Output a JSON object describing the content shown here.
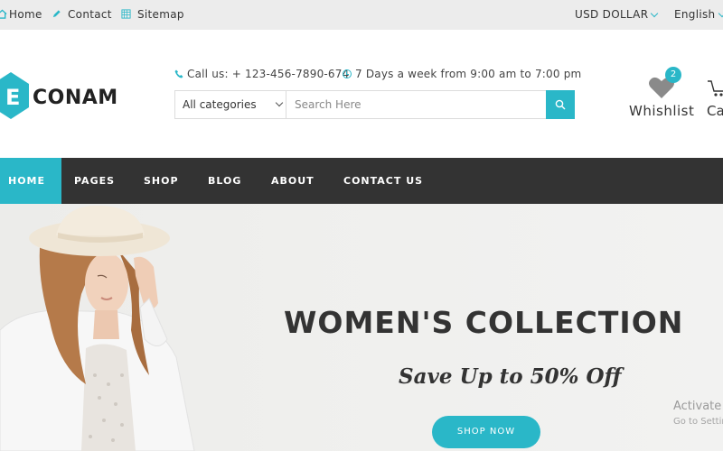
{
  "topbar": {
    "links": [
      {
        "label": "Home",
        "icon": "home-icon"
      },
      {
        "label": "Contact",
        "icon": "pencil-icon"
      },
      {
        "label": "Sitemap",
        "icon": "sitemap-icon"
      }
    ],
    "currency": "USD DOLLAR",
    "language": "English"
  },
  "header": {
    "logo_letter": "E",
    "logo_text": "CONAM",
    "call_text": "Call us: + 123-456-7890-674",
    "hours_text": "7 Days a week from 9:00 am to 7:00 pm",
    "category_selected": "All categories",
    "search_placeholder": "Search Here",
    "wishlist_label": "Whishlist",
    "wishlist_count": "2",
    "cart_label": "Ca"
  },
  "nav": {
    "items": [
      "HOME",
      "PAGES",
      "SHOP",
      "BLOG",
      "ABOUT",
      "CONTACT US"
    ],
    "active_index": 0
  },
  "hero": {
    "title": "WOMEN'S COLLECTION",
    "subtitle": "Save Up to 50% Off",
    "button_label": "SHOP NOW"
  },
  "watermark": {
    "line1": "Activate",
    "line2": "Go to Settin"
  },
  "colors": {
    "accent": "#2ab7c8",
    "nav_bg": "#333333",
    "topbar_bg": "#ececec"
  }
}
